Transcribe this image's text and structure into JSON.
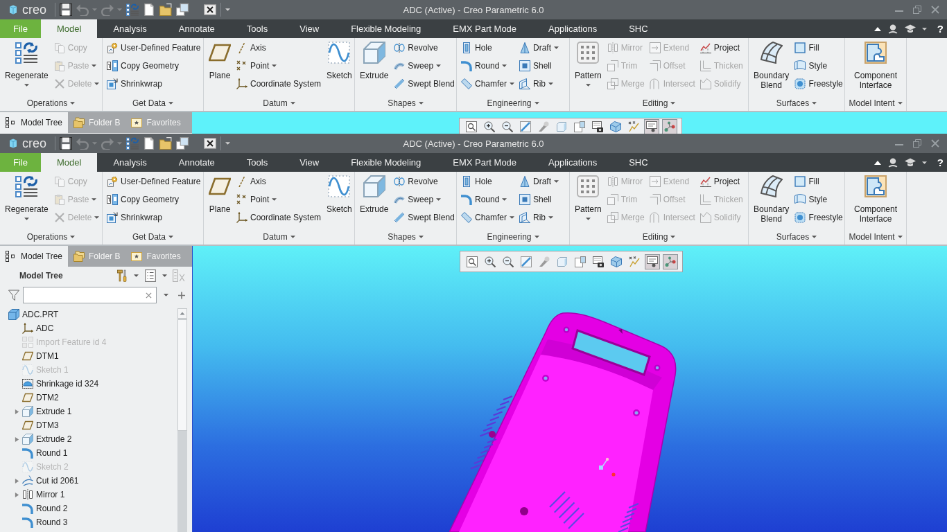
{
  "windows": [
    {
      "title": "ADC (Active) - Creo Parametric 6.0",
      "logo": "creo",
      "quick_access": [
        {
          "kind": "save",
          "disabled": false,
          "dropdown": false
        },
        {
          "kind": "undo",
          "disabled": true,
          "dropdown": true
        },
        {
          "kind": "redo",
          "disabled": true,
          "dropdown": true
        },
        {
          "kind": "regenerate",
          "disabled": false,
          "dropdown": false
        },
        {
          "kind": "new",
          "disabled": false,
          "dropdown": false
        },
        {
          "kind": "open",
          "disabled": false,
          "dropdown": false
        },
        {
          "kind": "windows",
          "disabled": false,
          "dropdown": false
        },
        {
          "kind": "close",
          "disabled": false,
          "dropdown": false
        }
      ],
      "tabs": [
        {
          "label": "File",
          "kind": "file",
          "selected": false
        },
        {
          "label": "Model",
          "kind": "tab",
          "selected": true
        },
        {
          "label": "Analysis",
          "kind": "tab",
          "selected": false
        },
        {
          "label": "Annotate",
          "kind": "tab",
          "selected": false
        },
        {
          "label": "Tools",
          "kind": "tab",
          "selected": false
        },
        {
          "label": "View",
          "kind": "tab",
          "selected": false
        },
        {
          "label": "Flexible Modeling",
          "kind": "tab",
          "selected": false
        },
        {
          "label": "EMX Part Mode",
          "kind": "tab",
          "selected": false
        },
        {
          "label": "Applications",
          "kind": "tab",
          "selected": false
        },
        {
          "label": "SHC",
          "kind": "tab",
          "selected": false
        }
      ],
      "help_label": "?",
      "ribbon": [
        {
          "label": "Operations",
          "columns": [
            [
              {
                "label": "Regenerate",
                "kind": "regenerate",
                "disabled": false,
                "dropdown": true
              }
            ],
            [
              {
                "label": "Copy",
                "kind": "copy",
                "disabled": true,
                "dropdown": false
              },
              {
                "label": "Paste",
                "kind": "paste",
                "disabled": true,
                "dropdown": true
              },
              {
                "label": "Delete",
                "kind": "delete",
                "disabled": true,
                "dropdown": true
              }
            ]
          ]
        },
        {
          "label": "Get Data",
          "columns": [
            [
              {
                "label": "User-Defined Feature",
                "kind": "udf",
                "disabled": false,
                "dropdown": false
              },
              {
                "label": "Copy Geometry",
                "kind": "copy_geometry",
                "disabled": false,
                "dropdown": false
              },
              {
                "label": "Shrinkwrap",
                "kind": "shrinkwrap",
                "disabled": false,
                "dropdown": false
              }
            ]
          ]
        },
        {
          "label": "Datum",
          "columns": [
            [
              {
                "label": "Plane",
                "kind": "plane",
                "disabled": false,
                "dropdown": false
              }
            ],
            [
              {
                "label": "Axis",
                "kind": "axis",
                "disabled": false,
                "dropdown": false
              },
              {
                "label": "Point",
                "kind": "point",
                "disabled": false,
                "dropdown": true
              },
              {
                "label": "Coordinate System",
                "kind": "csys",
                "disabled": false,
                "dropdown": false
              }
            ],
            [
              {
                "label": "Sketch",
                "kind": "sketch",
                "disabled": false,
                "dropdown": false
              }
            ]
          ]
        },
        {
          "label": "Shapes",
          "columns": [
            [
              {
                "label": "Extrude",
                "kind": "extrude",
                "disabled": false,
                "dropdown": false
              }
            ],
            [
              {
                "label": "Revolve",
                "kind": "revolve",
                "disabled": false,
                "dropdown": false
              },
              {
                "label": "Sweep",
                "kind": "sweep",
                "disabled": false,
                "dropdown": true
              },
              {
                "label": "Swept Blend",
                "kind": "swept_blend",
                "disabled": false,
                "dropdown": false
              }
            ]
          ]
        },
        {
          "label": "Engineering",
          "columns": [
            [
              {
                "label": "Hole",
                "kind": "hole",
                "disabled": false,
                "dropdown": false
              },
              {
                "label": "Round",
                "kind": "round",
                "disabled": false,
                "dropdown": true
              },
              {
                "label": "Chamfer",
                "kind": "chamfer",
                "disabled": false,
                "dropdown": true
              }
            ],
            [
              {
                "label": "Draft",
                "kind": "draft",
                "disabled": false,
                "dropdown": true
              },
              {
                "label": "Shell",
                "kind": "shell",
                "disabled": false,
                "dropdown": false
              },
              {
                "label": "Rib",
                "kind": "rib",
                "disabled": false,
                "dropdown": true
              }
            ]
          ]
        },
        {
          "label": "Editing",
          "columns": [
            [
              {
                "label": "Pattern",
                "kind": "pattern",
                "disabled": false,
                "dropdown": true
              }
            ],
            [
              {
                "label": "Mirror",
                "kind": "mirror",
                "disabled": true,
                "dropdown": false
              },
              {
                "label": "Trim",
                "kind": "trim",
                "disabled": true,
                "dropdown": false
              },
              {
                "label": "Merge",
                "kind": "merge",
                "disabled": true,
                "dropdown": false
              }
            ],
            [
              {
                "label": "Extend",
                "kind": "extend",
                "disabled": true,
                "dropdown": false
              },
              {
                "label": "Offset",
                "kind": "offset",
                "disabled": true,
                "dropdown": false
              },
              {
                "label": "Intersect",
                "kind": "intersect",
                "disabled": true,
                "dropdown": false
              }
            ],
            [
              {
                "label": "Project",
                "kind": "project",
                "disabled": false,
                "dropdown": false
              },
              {
                "label": "Thicken",
                "kind": "thicken",
                "disabled": true,
                "dropdown": false
              },
              {
                "label": "Solidify",
                "kind": "solidify",
                "disabled": true,
                "dropdown": false
              }
            ]
          ]
        },
        {
          "label": "Surfaces",
          "columns": [
            [
              {
                "label": "Boundary Blend",
                "kind": "boundary_blend",
                "disabled": false,
                "dropdown": false
              }
            ],
            [
              {
                "label": "Fill",
                "kind": "fill",
                "disabled": false,
                "dropdown": false
              },
              {
                "label": "Style",
                "kind": "style",
                "disabled": false,
                "dropdown": false
              },
              {
                "label": "Freestyle",
                "kind": "freestyle",
                "disabled": false,
                "dropdown": false
              }
            ]
          ]
        },
        {
          "label": "Model Intent",
          "columns": [
            [
              {
                "label": "Component Interface",
                "kind": "component_interface",
                "disabled": false,
                "dropdown": false
              }
            ]
          ]
        }
      ],
      "navigator_tabs": [
        {
          "label": "Model Tree",
          "kind": "model_tree",
          "selected": true
        },
        {
          "label": "Folder B",
          "kind": "folder",
          "selected": false
        },
        {
          "label": "Favorites",
          "kind": "favorites",
          "selected": false
        }
      ],
      "view_toolbar": [
        {
          "kind": "refit",
          "on": false
        },
        {
          "kind": "zoom_in",
          "on": false
        },
        {
          "kind": "zoom_out",
          "on": false
        },
        {
          "kind": "repaint",
          "on": false
        },
        {
          "kind": "shade",
          "on": false
        },
        {
          "kind": "named_view",
          "on": false
        },
        {
          "kind": "saved_views",
          "on": false
        },
        {
          "kind": "view_manager",
          "on": false
        },
        {
          "kind": "appearance",
          "on": false
        },
        {
          "kind": "datum_display",
          "on": false
        },
        {
          "kind": "annotation_display",
          "on": true
        },
        {
          "kind": "spin_center",
          "on": true
        }
      ]
    },
    {
      "title": "ADC (Active) - Creo Parametric 6.0",
      "logo": "creo",
      "quick_access": [
        {
          "kind": "save",
          "disabled": false,
          "dropdown": false
        },
        {
          "kind": "undo",
          "disabled": true,
          "dropdown": true
        },
        {
          "kind": "redo",
          "disabled": true,
          "dropdown": true
        },
        {
          "kind": "regenerate",
          "disabled": false,
          "dropdown": false
        },
        {
          "kind": "new",
          "disabled": false,
          "dropdown": false
        },
        {
          "kind": "open",
          "disabled": false,
          "dropdown": false
        },
        {
          "kind": "windows",
          "disabled": false,
          "dropdown": false
        },
        {
          "kind": "close",
          "disabled": false,
          "dropdown": false
        }
      ],
      "tabs": [
        {
          "label": "File",
          "kind": "file",
          "selected": false
        },
        {
          "label": "Model",
          "kind": "tab",
          "selected": true
        },
        {
          "label": "Analysis",
          "kind": "tab",
          "selected": false
        },
        {
          "label": "Annotate",
          "kind": "tab",
          "selected": false
        },
        {
          "label": "Tools",
          "kind": "tab",
          "selected": false
        },
        {
          "label": "View",
          "kind": "tab",
          "selected": false
        },
        {
          "label": "Flexible Modeling",
          "kind": "tab",
          "selected": false
        },
        {
          "label": "EMX Part Mode",
          "kind": "tab",
          "selected": false
        },
        {
          "label": "Applications",
          "kind": "tab",
          "selected": false
        },
        {
          "label": "SHC",
          "kind": "tab",
          "selected": false
        }
      ],
      "help_label": "?",
      "ribbon": [
        {
          "label": "Operations",
          "columns": [
            [
              {
                "label": "Regenerate",
                "kind": "regenerate",
                "disabled": false,
                "dropdown": true
              }
            ],
            [
              {
                "label": "Copy",
                "kind": "copy",
                "disabled": true,
                "dropdown": false
              },
              {
                "label": "Paste",
                "kind": "paste",
                "disabled": true,
                "dropdown": true
              },
              {
                "label": "Delete",
                "kind": "delete",
                "disabled": true,
                "dropdown": true
              }
            ]
          ]
        },
        {
          "label": "Get Data",
          "columns": [
            [
              {
                "label": "User-Defined Feature",
                "kind": "udf",
                "disabled": false,
                "dropdown": false
              },
              {
                "label": "Copy Geometry",
                "kind": "copy_geometry",
                "disabled": false,
                "dropdown": false
              },
              {
                "label": "Shrinkwrap",
                "kind": "shrinkwrap",
                "disabled": false,
                "dropdown": false
              }
            ]
          ]
        },
        {
          "label": "Datum",
          "columns": [
            [
              {
                "label": "Plane",
                "kind": "plane",
                "disabled": false,
                "dropdown": false
              }
            ],
            [
              {
                "label": "Axis",
                "kind": "axis",
                "disabled": false,
                "dropdown": false
              },
              {
                "label": "Point",
                "kind": "point",
                "disabled": false,
                "dropdown": true
              },
              {
                "label": "Coordinate System",
                "kind": "csys",
                "disabled": false,
                "dropdown": false
              }
            ],
            [
              {
                "label": "Sketch",
                "kind": "sketch",
                "disabled": false,
                "dropdown": false
              }
            ]
          ]
        },
        {
          "label": "Shapes",
          "columns": [
            [
              {
                "label": "Extrude",
                "kind": "extrude",
                "disabled": false,
                "dropdown": false
              }
            ],
            [
              {
                "label": "Revolve",
                "kind": "revolve",
                "disabled": false,
                "dropdown": false
              },
              {
                "label": "Sweep",
                "kind": "sweep",
                "disabled": false,
                "dropdown": true
              },
              {
                "label": "Swept Blend",
                "kind": "swept_blend",
                "disabled": false,
                "dropdown": false
              }
            ]
          ]
        },
        {
          "label": "Engineering",
          "columns": [
            [
              {
                "label": "Hole",
                "kind": "hole",
                "disabled": false,
                "dropdown": false
              },
              {
                "label": "Round",
                "kind": "round",
                "disabled": false,
                "dropdown": true
              },
              {
                "label": "Chamfer",
                "kind": "chamfer",
                "disabled": false,
                "dropdown": true
              }
            ],
            [
              {
                "label": "Draft",
                "kind": "draft",
                "disabled": false,
                "dropdown": true
              },
              {
                "label": "Shell",
                "kind": "shell",
                "disabled": false,
                "dropdown": false
              },
              {
                "label": "Rib",
                "kind": "rib",
                "disabled": false,
                "dropdown": true
              }
            ]
          ]
        },
        {
          "label": "Editing",
          "columns": [
            [
              {
                "label": "Pattern",
                "kind": "pattern",
                "disabled": false,
                "dropdown": true
              }
            ],
            [
              {
                "label": "Mirror",
                "kind": "mirror",
                "disabled": true,
                "dropdown": false
              },
              {
                "label": "Trim",
                "kind": "trim",
                "disabled": true,
                "dropdown": false
              },
              {
                "label": "Merge",
                "kind": "merge",
                "disabled": true,
                "dropdown": false
              }
            ],
            [
              {
                "label": "Extend",
                "kind": "extend",
                "disabled": true,
                "dropdown": false
              },
              {
                "label": "Offset",
                "kind": "offset",
                "disabled": true,
                "dropdown": false
              },
              {
                "label": "Intersect",
                "kind": "intersect",
                "disabled": true,
                "dropdown": false
              }
            ],
            [
              {
                "label": "Project",
                "kind": "project",
                "disabled": false,
                "dropdown": false
              },
              {
                "label": "Thicken",
                "kind": "thicken",
                "disabled": true,
                "dropdown": false
              },
              {
                "label": "Solidify",
                "kind": "solidify",
                "disabled": true,
                "dropdown": false
              }
            ]
          ]
        },
        {
          "label": "Surfaces",
          "columns": [
            [
              {
                "label": "Boundary Blend",
                "kind": "boundary_blend",
                "disabled": false,
                "dropdown": false
              }
            ],
            [
              {
                "label": "Fill",
                "kind": "fill",
                "disabled": false,
                "dropdown": false
              },
              {
                "label": "Style",
                "kind": "style",
                "disabled": false,
                "dropdown": false
              },
              {
                "label": "Freestyle",
                "kind": "freestyle",
                "disabled": false,
                "dropdown": false
              }
            ]
          ]
        },
        {
          "label": "Model Intent",
          "columns": [
            [
              {
                "label": "Component Interface",
                "kind": "component_interface",
                "disabled": false,
                "dropdown": false
              }
            ]
          ]
        }
      ],
      "navigator_tabs": [
        {
          "label": "Model Tree",
          "kind": "model_tree",
          "selected": true
        },
        {
          "label": "Folder B",
          "kind": "folder",
          "selected": false
        },
        {
          "label": "Favorites",
          "kind": "favorites",
          "selected": false
        }
      ],
      "model_tree": {
        "title": "Model Tree",
        "items": [
          {
            "label": "ADC.PRT",
            "kind": "part",
            "disabled": false,
            "children": [
              {
                "label": "ADC",
                "kind": "csys",
                "disabled": false
              },
              {
                "label": "Import Feature id 4",
                "kind": "import",
                "disabled": true
              },
              {
                "label": "DTM1",
                "kind": "plane",
                "disabled": false
              },
              {
                "label": "Sketch 1",
                "kind": "sketch",
                "disabled": true
              },
              {
                "label": "Shrinkage id 324",
                "kind": "shrinkage",
                "disabled": false
              },
              {
                "label": "DTM2",
                "kind": "plane",
                "disabled": false
              },
              {
                "label": "Extrude 1",
                "kind": "extrude",
                "disabled": false,
                "expanded": false
              },
              {
                "label": "DTM3",
                "kind": "plane",
                "disabled": false
              },
              {
                "label": "Extrude 2",
                "kind": "extrude",
                "disabled": false,
                "expanded": false
              },
              {
                "label": "Round 1",
                "kind": "round",
                "disabled": false
              },
              {
                "label": "Sketch 2",
                "kind": "sketch",
                "disabled": true
              },
              {
                "label": "Cut id 2061",
                "kind": "cut",
                "disabled": false,
                "expanded": false
              },
              {
                "label": "Mirror 1",
                "kind": "mirror",
                "disabled": false,
                "expanded": false
              },
              {
                "label": "Round 2",
                "kind": "round",
                "disabled": false
              },
              {
                "label": "Round 3",
                "kind": "round",
                "disabled": false
              }
            ]
          }
        ]
      },
      "view_toolbar": [
        {
          "kind": "refit",
          "on": false
        },
        {
          "kind": "zoom_in",
          "on": false
        },
        {
          "kind": "zoom_out",
          "on": false
        },
        {
          "kind": "repaint",
          "on": false
        },
        {
          "kind": "shade",
          "on": false
        },
        {
          "kind": "named_view",
          "on": false
        },
        {
          "kind": "saved_views",
          "on": false
        },
        {
          "kind": "view_manager",
          "on": false
        },
        {
          "kind": "appearance",
          "on": false
        },
        {
          "kind": "datum_display",
          "on": false
        },
        {
          "kind": "annotation_display",
          "on": true
        },
        {
          "kind": "spin_center",
          "on": true
        }
      ]
    }
  ]
}
